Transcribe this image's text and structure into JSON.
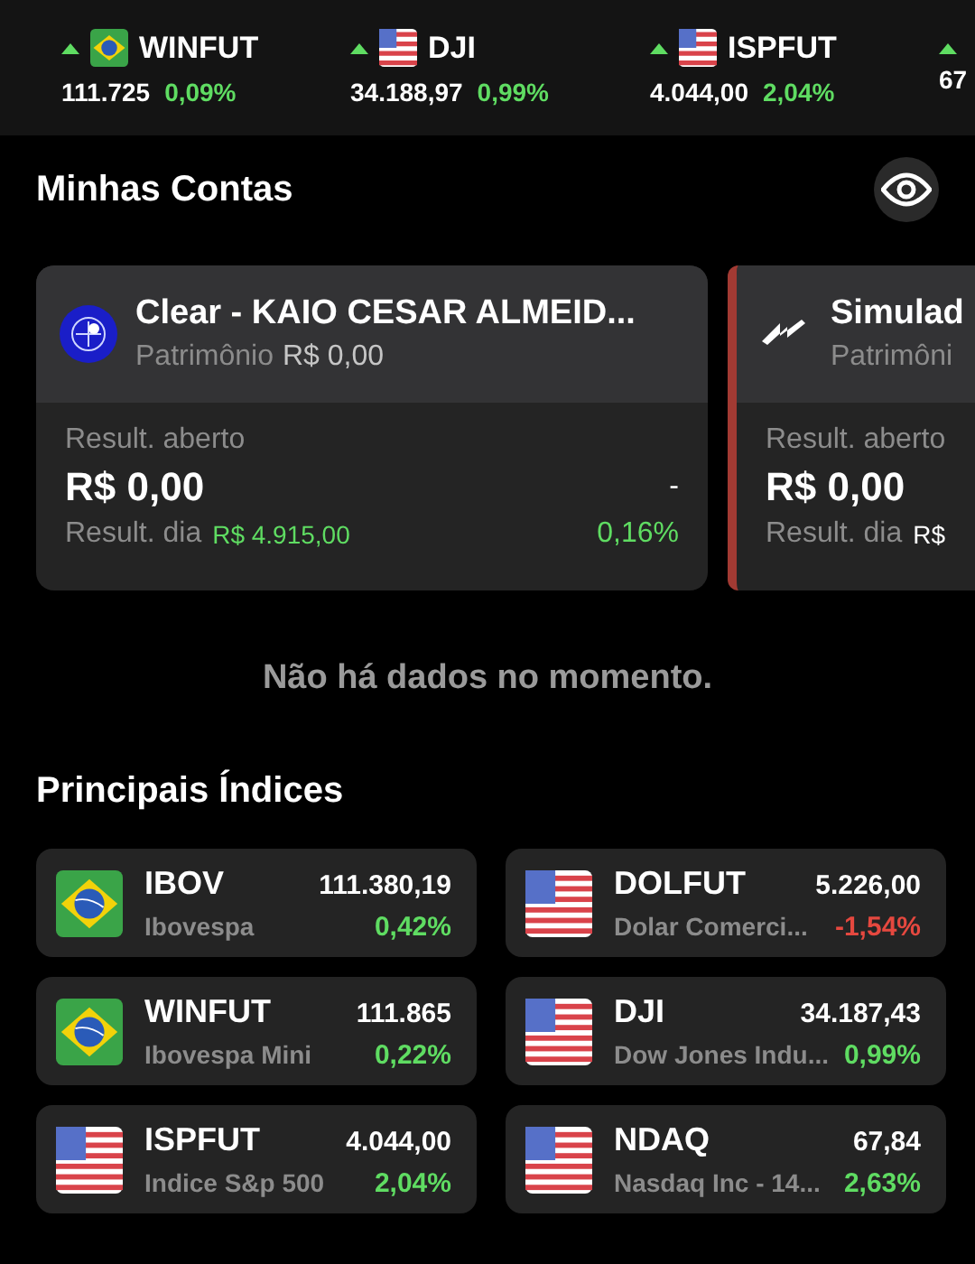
{
  "ticker": [
    {
      "rising": true,
      "kind": "br",
      "symbol": "WINFUT",
      "price": "111.725",
      "change": "0,09%"
    },
    {
      "rising": true,
      "kind": "us",
      "symbol": "DJI",
      "price": "34.188,97",
      "change": "0,99%"
    },
    {
      "rising": true,
      "kind": "us",
      "symbol": "ISPFUT",
      "price": "4.044,00",
      "change": "2,04%"
    },
    {
      "rising": true,
      "price": "67"
    }
  ],
  "accounts_title": "Minhas Contas",
  "accounts": [
    {
      "kind": "broker",
      "name": "Clear - KAIO CESAR ALMEID...",
      "equity_label": "Patrimônio",
      "equity": "R$ 0,00",
      "open_label": "Result. aberto",
      "open_value": "R$ 0,00",
      "open_change": "-",
      "day_label": "Result. dia",
      "day_value": "R$ 4.915,00",
      "day_positive": true,
      "day_change": "0,16%"
    },
    {
      "kind": "simulator",
      "name": "Simulad",
      "equity_label": "Patrimôni",
      "open_label": "Result. aberto",
      "open_value": "R$ 0,00",
      "day_label": "Result. dia",
      "day_value": "R$",
      "day_positive": false
    }
  ],
  "empty_message": "Não há dados no momento.",
  "indices_title": "Principais Índices",
  "indices": [
    {
      "kind": "br",
      "symbol": "IBOV",
      "price": "111.380,19",
      "name": "Ibovespa",
      "change": "0,42%",
      "rising": true
    },
    {
      "kind": "us",
      "symbol": "DOLFUT",
      "price": "5.226,00",
      "name": "Dolar Comerci...",
      "change": "-1,54%",
      "rising": false
    },
    {
      "kind": "br",
      "symbol": "WINFUT",
      "price": "111.865",
      "name": "Ibovespa Mini",
      "change": "0,22%",
      "rising": true
    },
    {
      "kind": "us",
      "symbol": "DJI",
      "price": "34.187,43",
      "name": "Dow Jones Indu...",
      "change": "0,99%",
      "rising": true
    },
    {
      "kind": "us",
      "symbol": "ISPFUT",
      "price": "4.044,00",
      "name": "Indice S&p 500",
      "change": "2,04%",
      "rising": true
    },
    {
      "kind": "us",
      "symbol": "NDAQ",
      "price": "67,84",
      "name": "Nasdaq Inc - 14...",
      "change": "2,63%",
      "rising": true
    }
  ]
}
